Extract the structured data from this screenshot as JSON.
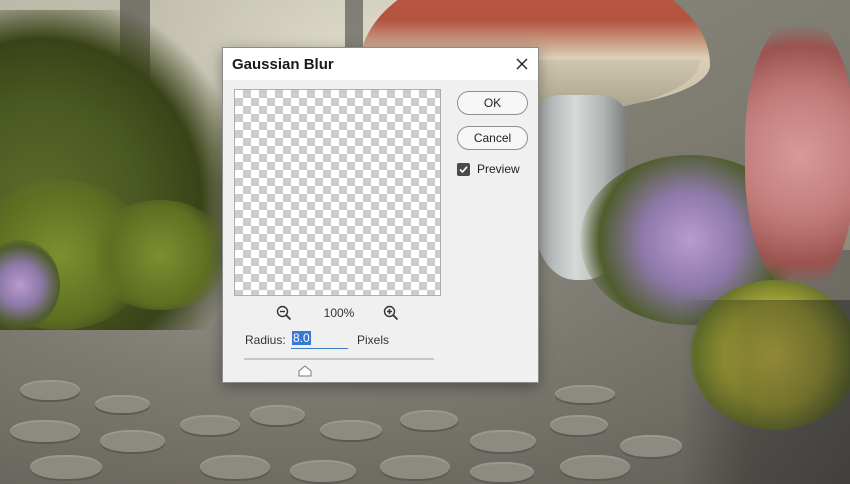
{
  "dialog": {
    "title": "Gaussian Blur",
    "ok_label": "OK",
    "cancel_label": "Cancel",
    "preview_label": "Preview",
    "preview_checked": true,
    "zoom_level": "100%",
    "radius_label": "Radius:",
    "radius_value": "8.0",
    "units_label": "Pixels",
    "slider_level_fraction": 0.32
  },
  "icons": {
    "close": "close-icon",
    "zoom_out": "zoom-out-icon",
    "zoom_in": "zoom-in-icon",
    "checkbox": "checkmark-icon",
    "slider": "slider-thumb-icon"
  },
  "colors": {
    "dialog_bg": "#f0f0f0",
    "titlebar_bg": "#ffffff",
    "selection": "#3a78d6",
    "checkbox_fill": "#4a4a4a"
  }
}
